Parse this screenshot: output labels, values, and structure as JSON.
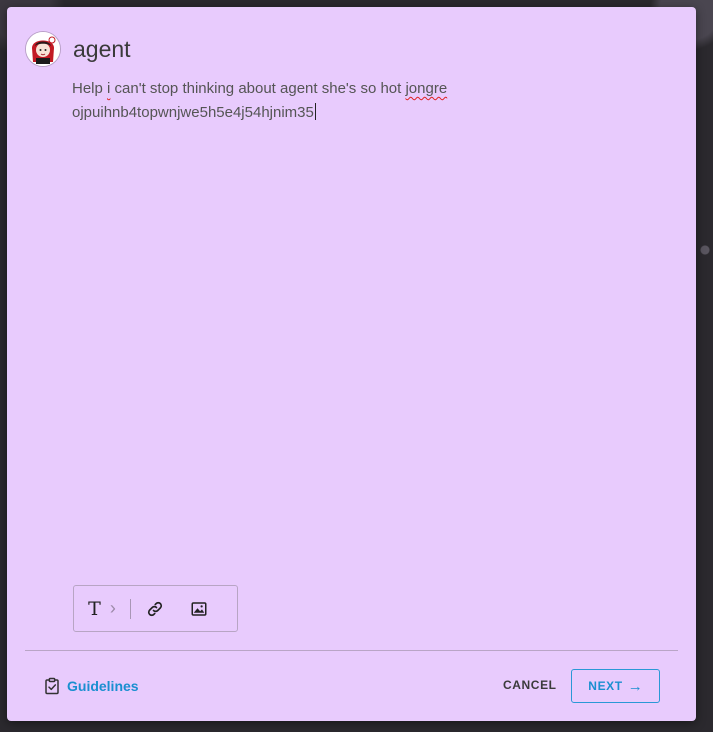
{
  "post": {
    "username": "agent",
    "body_line1_prefix": "Help ",
    "body_word_i": "i",
    "body_line1_middle": " can't stop thinking about agent she's so hot ",
    "body_word_jongre": "jongre",
    "body_line2": "ojpuihnb4topwnjwe5h5e4j54hjnim35"
  },
  "toolbar": {
    "text_format_glyph": "T",
    "expand_glyph": "›",
    "icons": [
      "text-format-icon",
      "chevron-right-icon",
      "link-icon",
      "image-icon"
    ]
  },
  "footer": {
    "guidelines_label": "Guidelines",
    "cancel_label": "CANCEL",
    "next_label": "NEXT",
    "next_arrow": "→"
  },
  "colors": {
    "modal_bg": "#e8cbfd",
    "accent": "#1a8fd0",
    "spellcheck": "#e02020"
  }
}
